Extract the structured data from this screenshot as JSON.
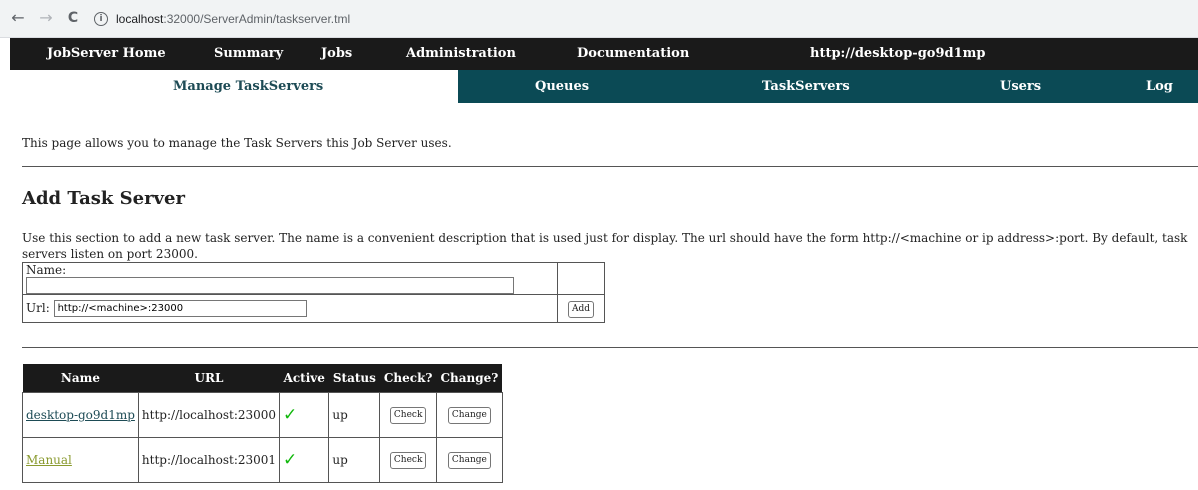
{
  "browser": {
    "back_icon": "←",
    "forward_icon": "→",
    "reload_icon": "C",
    "info_icon": "i",
    "url_host": "localhost",
    "url_path": ":32000/ServerAdmin/taskserver.tml"
  },
  "topnav": {
    "items": [
      "JobServer Home",
      "Summary",
      "Jobs",
      "Administration",
      "Documentation"
    ],
    "host": "http://desktop-go9d1mp"
  },
  "subnav": {
    "active": "Manage TaskServers",
    "items": [
      "Queues",
      "TaskServers",
      "Users",
      "Log"
    ]
  },
  "page": {
    "intro": "This page allows you to manage the Task Servers this Job Server uses."
  },
  "add_section": {
    "title": "Add Task Server",
    "description": "Use this section to add a new task server. The name is a convenient description that is used just for display. The url should have the form http://<machine or ip address>:port. By default, task servers listen on port 23000.",
    "name_label": "Name:",
    "name_value": "",
    "url_label": "Url:",
    "url_value": "http://<machine>:23000",
    "add_label": "Add"
  },
  "servers": {
    "headers": [
      "Name",
      "URL",
      "Active",
      "Status",
      "Check?",
      "Change?"
    ],
    "rows": [
      {
        "name": "desktop-go9d1mp",
        "url": "http://localhost:23000",
        "active": "✓",
        "status": "up",
        "check": "Check",
        "change": "Change"
      },
      {
        "name": "Manual",
        "url": "http://localhost:23001",
        "active": "✓",
        "status": "up",
        "check": "Check",
        "change": "Change"
      }
    ]
  },
  "colors": {
    "nav_dark": "#1a1a1a",
    "subnav_teal": "#0b4a55",
    "link_teal": "#1d4b55",
    "link_olive": "#8a9a2f",
    "check_green": "#11b80c"
  }
}
